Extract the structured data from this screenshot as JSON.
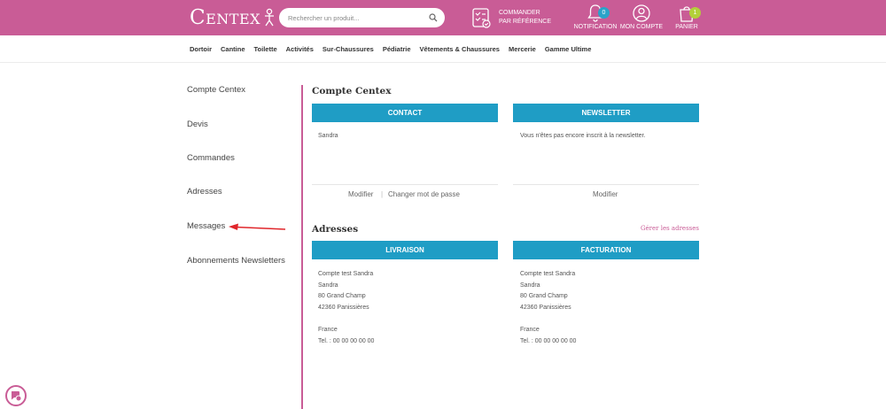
{
  "header": {
    "logo_text": "Centex",
    "search_placeholder": "Rechercher un produit...",
    "command_ref": "COMMANDER PAR RÉFÉRENCE",
    "notification_label": "NOTIFICATION",
    "notification_count": "0",
    "account_label": "MON COMPTE",
    "cart_label": "PANIER",
    "cart_count": "1",
    "colors": {
      "brand": "#c95c96",
      "notification_badge": "#2aa3c9",
      "cart_badge": "#b3cf3a"
    }
  },
  "nav": [
    "Dortoir",
    "Cantine",
    "Toilette",
    "Activités",
    "Sur-Chaussures",
    "Pédiatrie",
    "Vêtements & Chaussures",
    "Mercerie",
    "Gamme Ultime"
  ],
  "sidebar": {
    "items": [
      "Compte Centex",
      "Devis",
      "Commandes",
      "Adresses",
      "Messages",
      "Abonnements Newsletters"
    ]
  },
  "account": {
    "title": "Compte Centex",
    "contact": {
      "header": "CONTACT",
      "text": "Sandra",
      "modify": "Modifier",
      "change_password": "Changer mot de passe"
    },
    "newsletter": {
      "header": "NEWSLETTER",
      "text": "Vous n'êtes pas encore inscrit à la newsletter.",
      "modify": "Modifier"
    }
  },
  "addresses": {
    "title": "Adresses",
    "manage_link": "Gérer les adresses",
    "delivery": {
      "header": "LIVRAISON",
      "lines": [
        "Compte test Sandra",
        "Sandra",
        "80 Grand Champ",
        "42360 Panissières",
        "",
        "France",
        "Tel. : 00 00 00 00 00"
      ]
    },
    "billing": {
      "header": "FACTURATION",
      "lines": [
        "Compte test Sandra",
        "Sandra",
        "80 Grand Champ",
        "42360 Panissières",
        "",
        "France",
        "Tel. : 00 00 00 00 00"
      ]
    }
  },
  "accent_colors": {
    "brand_pink": "#c95c96",
    "box_blue": "#1f9dc5",
    "annotation_arrow": "#e0262b"
  }
}
